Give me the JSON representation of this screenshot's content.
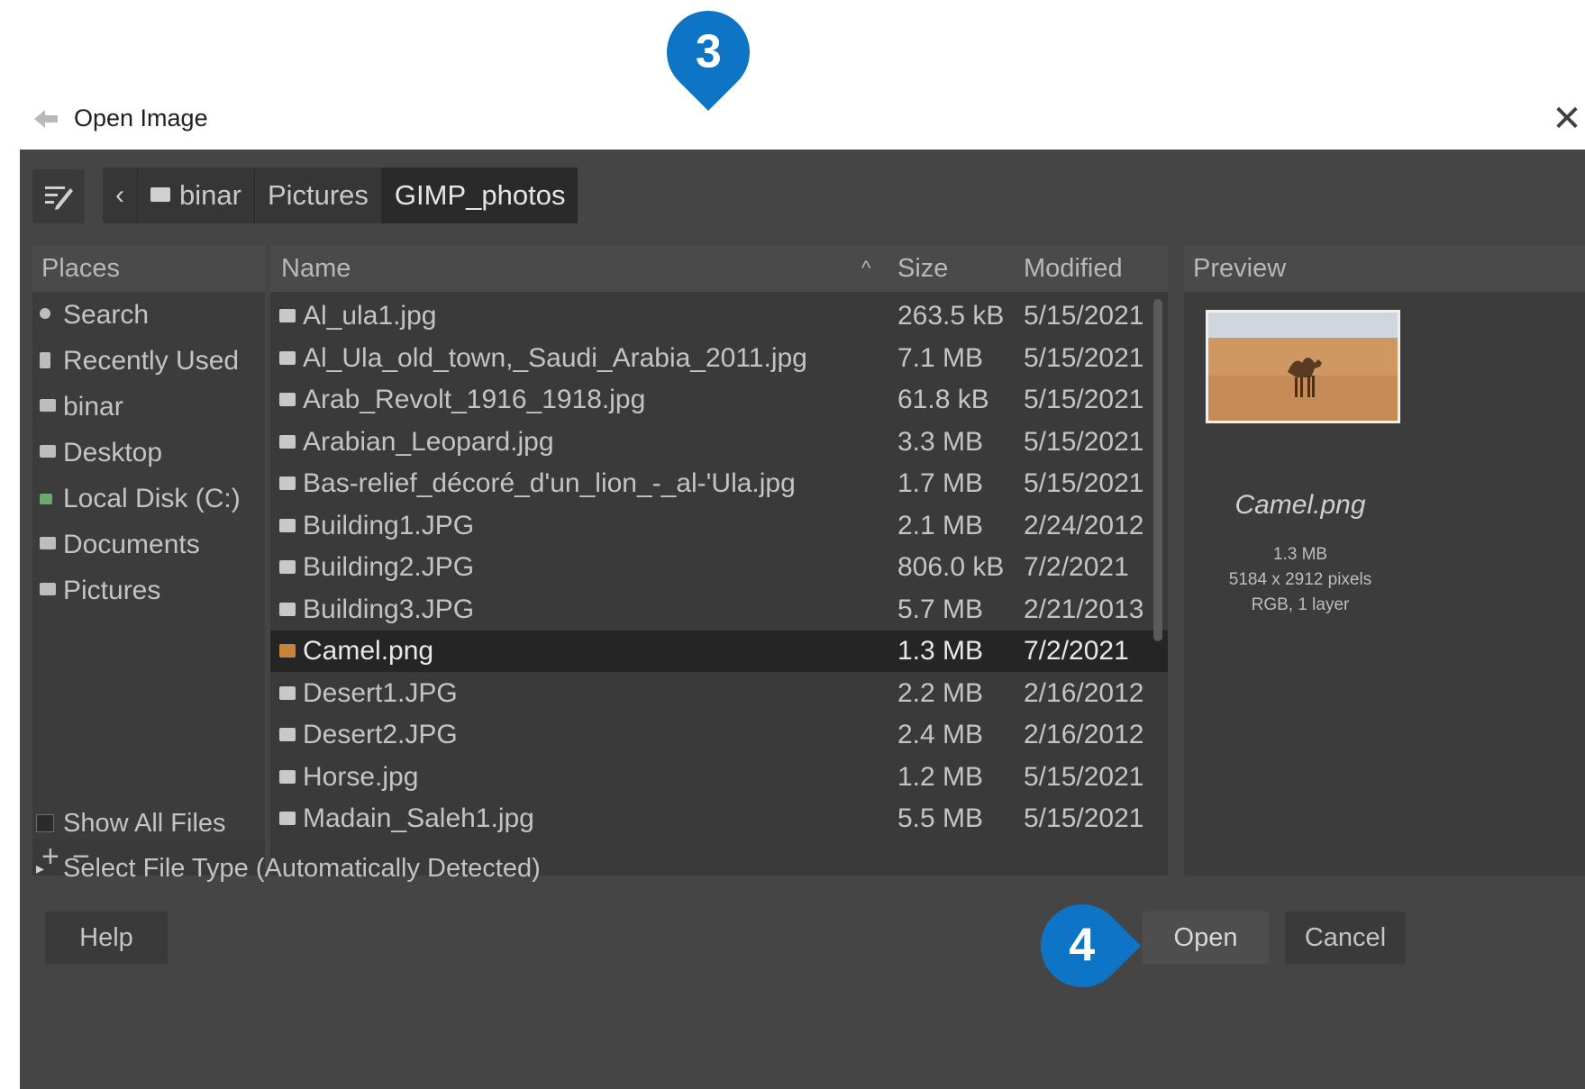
{
  "dialog": {
    "title": "Open Image",
    "close_glyph": "✕"
  },
  "toolbar": {
    "back_glyph": "‹",
    "breadcrumbs": [
      "binar",
      "Pictures",
      "GIMP_photos"
    ]
  },
  "places": {
    "header": "Places",
    "items": [
      {
        "label": "Search",
        "icon": "search-icon"
      },
      {
        "label": "Recently Used",
        "icon": "clock-icon"
      },
      {
        "label": "binar",
        "icon": "folder-icon"
      },
      {
        "label": "Desktop",
        "icon": "folder-icon"
      },
      {
        "label": "Local Disk (C:)",
        "icon": "disk-icon"
      },
      {
        "label": "Documents",
        "icon": "folder-icon"
      },
      {
        "label": "Pictures",
        "icon": "folder-icon"
      }
    ],
    "add_glyph": "+",
    "remove_glyph": "−"
  },
  "files": {
    "columns": {
      "name": "Name",
      "size": "Size",
      "modified": "Modified"
    },
    "sort_glyph": "^",
    "rows": [
      {
        "name": "Al_ula1.jpg",
        "size": "263.5 kB",
        "modified": "5/15/2021"
      },
      {
        "name": "Al_Ula_old_town,_Saudi_Arabia_2011.jpg",
        "size": "7.1 MB",
        "modified": "5/15/2021"
      },
      {
        "name": "Arab_Revolt_1916_1918.jpg",
        "size": "61.8 kB",
        "modified": "5/15/2021"
      },
      {
        "name": "Arabian_Leopard.jpg",
        "size": "3.3 MB",
        "modified": "5/15/2021"
      },
      {
        "name": "Bas-relief_décoré_d'un_lion_-_al-'Ula.jpg",
        "size": "1.7 MB",
        "modified": "5/15/2021"
      },
      {
        "name": "Building1.JPG",
        "size": "2.1 MB",
        "modified": "2/24/2012"
      },
      {
        "name": "Building2.JPG",
        "size": "806.0 kB",
        "modified": "7/2/2021"
      },
      {
        "name": "Building3.JPG",
        "size": "5.7 MB",
        "modified": "2/21/2013"
      },
      {
        "name": "Camel.png",
        "size": "1.3 MB",
        "modified": "7/2/2021",
        "selected": true
      },
      {
        "name": "Desert1.JPG",
        "size": "2.2 MB",
        "modified": "2/16/2012"
      },
      {
        "name": "Desert2.JPG",
        "size": "2.4 MB",
        "modified": "2/16/2012"
      },
      {
        "name": "Horse.jpg",
        "size": "1.2 MB",
        "modified": "5/15/2021"
      },
      {
        "name": "Madain_Saleh1.jpg",
        "size": "5.5 MB",
        "modified": "5/15/2021"
      }
    ]
  },
  "preview": {
    "header": "Preview",
    "filename": "Camel.png",
    "size": "1.3 MB",
    "dimensions": "5184 x 2912 pixels",
    "mode": "RGB, 1 layer"
  },
  "options": {
    "show_all_files": "Show All Files",
    "select_file_type": "Select File Type (Automatically Detected)"
  },
  "buttons": {
    "help": "Help",
    "open": "Open",
    "cancel": "Cancel"
  },
  "markers": [
    "3",
    "4"
  ],
  "colors": {
    "marker": "#0d74c6",
    "dialog_bg": "#454545",
    "selected_row": "#252525"
  }
}
